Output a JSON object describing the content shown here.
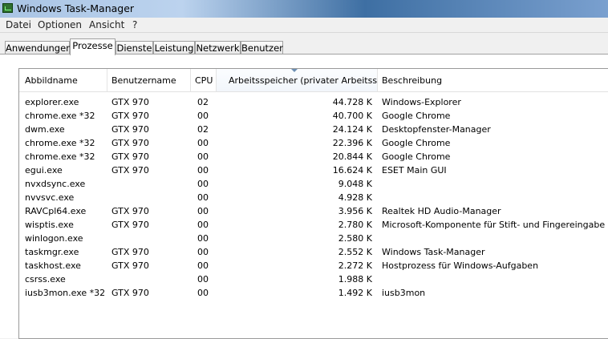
{
  "window": {
    "title": "Windows Task-Manager"
  },
  "menu": [
    "Datei",
    "Optionen",
    "Ansicht",
    "?"
  ],
  "tabs": [
    {
      "label": "Anwendungen",
      "active": false
    },
    {
      "label": "Prozesse",
      "active": true
    },
    {
      "label": "Dienste",
      "active": false
    },
    {
      "label": "Leistung",
      "active": false
    },
    {
      "label": "Netzwerk",
      "active": false
    },
    {
      "label": "Benutzer",
      "active": false
    }
  ],
  "columns": {
    "name": "Abbildname",
    "user": "Benutzername",
    "cpu": "CPU",
    "memory": "Arbeitsspeicher (privater Arbeitssatz)",
    "description": "Beschreibung"
  },
  "processes": [
    {
      "name": "explorer.exe",
      "user": "GTX 970",
      "cpu": "02",
      "memory": "44.728 K",
      "description": "Windows-Explorer"
    },
    {
      "name": "chrome.exe *32",
      "user": "GTX 970",
      "cpu": "00",
      "memory": "40.700 K",
      "description": "Google Chrome"
    },
    {
      "name": "dwm.exe",
      "user": "GTX 970",
      "cpu": "02",
      "memory": "24.124 K",
      "description": "Desktopfenster-Manager"
    },
    {
      "name": "chrome.exe *32",
      "user": "GTX 970",
      "cpu": "00",
      "memory": "22.396 K",
      "description": "Google Chrome"
    },
    {
      "name": "chrome.exe *32",
      "user": "GTX 970",
      "cpu": "00",
      "memory": "20.844 K",
      "description": "Google Chrome"
    },
    {
      "name": "egui.exe",
      "user": "GTX 970",
      "cpu": "00",
      "memory": "16.624 K",
      "description": "ESET Main GUI"
    },
    {
      "name": "nvxdsync.exe",
      "user": "",
      "cpu": "00",
      "memory": "9.048 K",
      "description": ""
    },
    {
      "name": "nvvsvc.exe",
      "user": "",
      "cpu": "00",
      "memory": "4.928 K",
      "description": ""
    },
    {
      "name": "RAVCpl64.exe",
      "user": "GTX 970",
      "cpu": "00",
      "memory": "3.956 K",
      "description": "Realtek HD Audio-Manager"
    },
    {
      "name": "wisptis.exe",
      "user": "GTX 970",
      "cpu": "00",
      "memory": "2.780 K",
      "description": "Microsoft-Komponente für Stift- und Fingereingabe"
    },
    {
      "name": "winlogon.exe",
      "user": "",
      "cpu": "00",
      "memory": "2.580 K",
      "description": ""
    },
    {
      "name": "taskmgr.exe",
      "user": "GTX 970",
      "cpu": "00",
      "memory": "2.552 K",
      "description": "Windows Task-Manager"
    },
    {
      "name": "taskhost.exe",
      "user": "GTX 970",
      "cpu": "00",
      "memory": "2.272 K",
      "description": "Hostprozess für Windows-Aufgaben"
    },
    {
      "name": "csrss.exe",
      "user": "",
      "cpu": "00",
      "memory": "1.988 K",
      "description": ""
    },
    {
      "name": "iusb3mon.exe *32",
      "user": "GTX 970",
      "cpu": "00",
      "memory": "1.492 K",
      "description": "iusb3mon"
    }
  ],
  "icons": {
    "app": "task-manager-icon",
    "sort": "sort-descending-icon"
  },
  "colors": {
    "title_bar_accent": "#3e6fa3",
    "sort_indicator": "#6d8fb3"
  }
}
